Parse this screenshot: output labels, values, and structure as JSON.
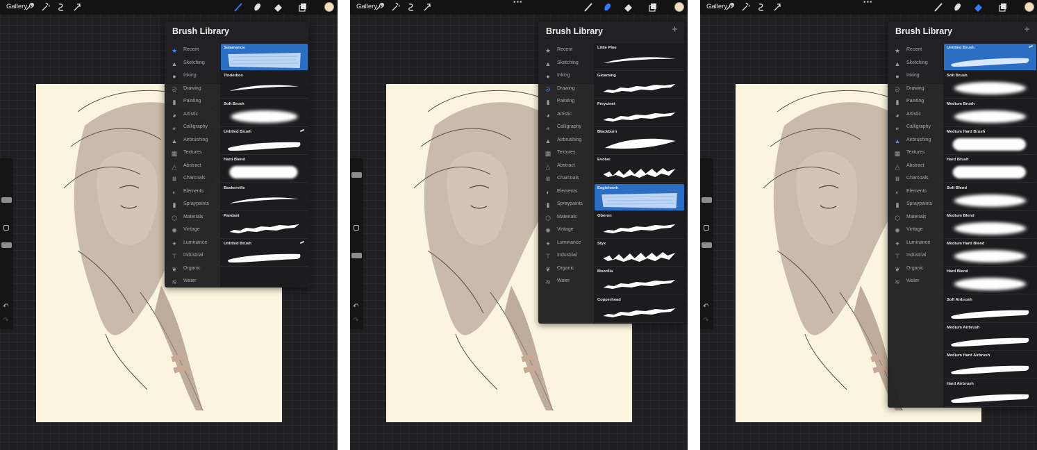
{
  "colors": {
    "accent": "#2a6fc4",
    "active_icon": "#3d8cff",
    "panel": "#212123",
    "canvas_paper": "#fbf5df",
    "swatch": "#f1dfb8"
  },
  "screens": [
    {
      "gallery_label": "Gallery",
      "active_tool": "brush",
      "library": {
        "title": "Brush Library",
        "show_plus": false,
        "active_category": 0,
        "categories": [
          "Recent",
          "Sketching",
          "Inking",
          "Drawing",
          "Painting",
          "Artistic",
          "Calligraphy",
          "Airbrushing",
          "Textures",
          "Abstract",
          "Charcoals",
          "Elements",
          "Spraypaints",
          "Materials",
          "Vintage",
          "Luminance",
          "Industrial",
          "Organic",
          "Water"
        ],
        "brushes": [
          {
            "name": "Salamanca",
            "style": "texture",
            "selected": true,
            "edited": false
          },
          {
            "name": "Tinderbox",
            "style": "thin",
            "selected": false,
            "edited": false
          },
          {
            "name": "Soft Brush",
            "style": "soft",
            "selected": false,
            "edited": false
          },
          {
            "name": "Untitled Brush",
            "style": "round",
            "selected": false,
            "edited": true
          },
          {
            "name": "Hard Blend",
            "style": "blend",
            "selected": false,
            "edited": false
          },
          {
            "name": "Baskerville",
            "style": "thin",
            "selected": false,
            "edited": false
          },
          {
            "name": "Pandani",
            "style": "rough",
            "selected": false,
            "edited": false
          },
          {
            "name": "Untitled Brush",
            "style": "round",
            "selected": false,
            "edited": true
          }
        ]
      }
    },
    {
      "gallery_label": "Gallery",
      "active_tool": "smudge",
      "library": {
        "title": "Brush Library",
        "show_plus": true,
        "active_category": 3,
        "categories": [
          "Recent",
          "Sketching",
          "Inking",
          "Drawing",
          "Painting",
          "Artistic",
          "Calligraphy",
          "Airbrushing",
          "Textures",
          "Abstract",
          "Charcoals",
          "Elements",
          "Spraypaints",
          "Materials",
          "Vintage",
          "Luminance",
          "Industrial",
          "Organic",
          "Water"
        ],
        "brushes": [
          {
            "name": "Little Pine",
            "style": "thin",
            "selected": false,
            "edited": false
          },
          {
            "name": "Gloaming",
            "style": "rough",
            "selected": false,
            "edited": false
          },
          {
            "name": "Freycinet",
            "style": "rough",
            "selected": false,
            "edited": false
          },
          {
            "name": "Blackburn",
            "style": "leaf",
            "selected": false,
            "edited": false
          },
          {
            "name": "Evolve",
            "style": "jagged",
            "selected": false,
            "edited": false
          },
          {
            "name": "Eaglehawk",
            "style": "texture",
            "selected": true,
            "edited": false
          },
          {
            "name": "Oberon",
            "style": "rough",
            "selected": false,
            "edited": false
          },
          {
            "name": "Styx",
            "style": "jagged",
            "selected": false,
            "edited": false
          },
          {
            "name": "Moorilla",
            "style": "rough",
            "selected": false,
            "edited": false
          },
          {
            "name": "Copperhead",
            "style": "rough",
            "selected": false,
            "edited": false
          }
        ]
      }
    },
    {
      "gallery_label": "Gallery",
      "active_tool": "eraser",
      "library": {
        "title": "Brush Library",
        "show_plus": true,
        "active_category": 7,
        "categories": [
          "Recent",
          "Sketching",
          "Inking",
          "Drawing",
          "Painting",
          "Artistic",
          "Calligraphy",
          "Airbrushing",
          "Textures",
          "Abstract",
          "Charcoals",
          "Elements",
          "Spraypaints",
          "Materials",
          "Vintage",
          "Luminance",
          "Industrial",
          "Organic",
          "Water"
        ],
        "brushes": [
          {
            "name": "Untitled Brush",
            "style": "round",
            "selected": true,
            "edited": true
          },
          {
            "name": "Soft Brush",
            "style": "soft",
            "selected": false,
            "edited": false
          },
          {
            "name": "Medium Brush",
            "style": "soft",
            "selected": false,
            "edited": false
          },
          {
            "name": "Medium Hard Brush",
            "style": "blend",
            "selected": false,
            "edited": false
          },
          {
            "name": "Hard Brush",
            "style": "blend",
            "selected": false,
            "edited": false
          },
          {
            "name": "Soft Blend",
            "style": "soft",
            "selected": false,
            "edited": false
          },
          {
            "name": "Medium Blend",
            "style": "soft",
            "selected": false,
            "edited": false
          },
          {
            "name": "Medium Hard Blend",
            "style": "soft",
            "selected": false,
            "edited": false
          },
          {
            "name": "Hard Blend",
            "style": "soft",
            "selected": false,
            "edited": false
          },
          {
            "name": "Soft Airbrush",
            "style": "round",
            "selected": false,
            "edited": false
          },
          {
            "name": "Medium Airbrush",
            "style": "round",
            "selected": false,
            "edited": false
          },
          {
            "name": "Medium Hard Airbrush",
            "style": "round",
            "selected": false,
            "edited": false
          },
          {
            "name": "Hard Airbrush",
            "style": "round",
            "selected": false,
            "edited": false
          }
        ]
      }
    }
  ]
}
